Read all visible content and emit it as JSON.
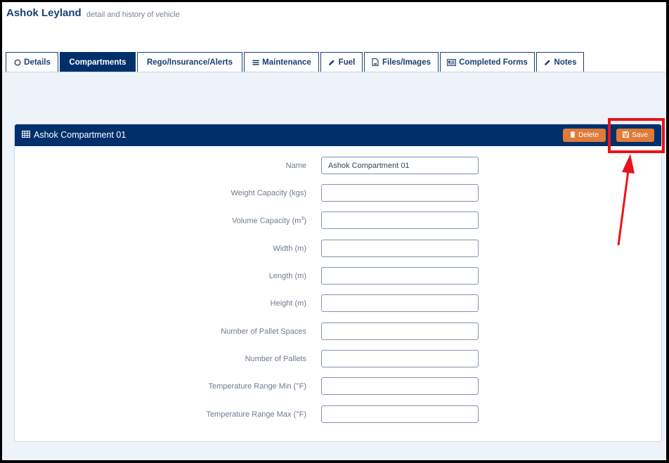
{
  "header": {
    "title": "Ashok Leyland",
    "subtitle": "detail and history of vehicle"
  },
  "tabs": [
    {
      "label": "Details",
      "icon": "circle-icon",
      "active": false
    },
    {
      "label": "Compartments",
      "icon": "",
      "active": true
    },
    {
      "label": "Rego/Insurance/Alerts",
      "icon": "",
      "active": false
    },
    {
      "label": "Maintenance",
      "icon": "list-icon",
      "active": false
    },
    {
      "label": "Fuel",
      "icon": "pencil-icon",
      "active": false
    },
    {
      "label": "Files/Images",
      "icon": "image-file-icon",
      "active": false
    },
    {
      "label": "Completed Forms",
      "icon": "form-card-icon",
      "active": false
    },
    {
      "label": "Notes",
      "icon": "pencil-icon",
      "active": false
    }
  ],
  "panel": {
    "title": "Ashok Compartment 01",
    "title_icon": "table-icon",
    "delete_label": "Delete",
    "delete_icon": "trash-icon",
    "save_label": "Save",
    "save_icon": "floppy-disk-icon"
  },
  "fields": [
    {
      "label": "Name",
      "value": "Ashok Compartment 01"
    },
    {
      "label": "Weight Capacity (kgs)",
      "value": ""
    },
    {
      "label_main": "Volume Capacity (m",
      "label_sup": "3",
      "label_end": ")",
      "value": ""
    },
    {
      "label": "Width (m)",
      "value": ""
    },
    {
      "label": "Length (m)",
      "value": ""
    },
    {
      "label": "Height (m)",
      "value": ""
    },
    {
      "label": "Number of Pallet Spaces",
      "value": ""
    },
    {
      "label": "Number of Pallets",
      "value": ""
    },
    {
      "label": "Temperature Range Min (°F)",
      "value": ""
    },
    {
      "label": "Temperature Range Max (°F)",
      "value": ""
    }
  ],
  "colors": {
    "primary": "#00306b",
    "accent": "#e07b39",
    "annotation": "#e8141b"
  }
}
